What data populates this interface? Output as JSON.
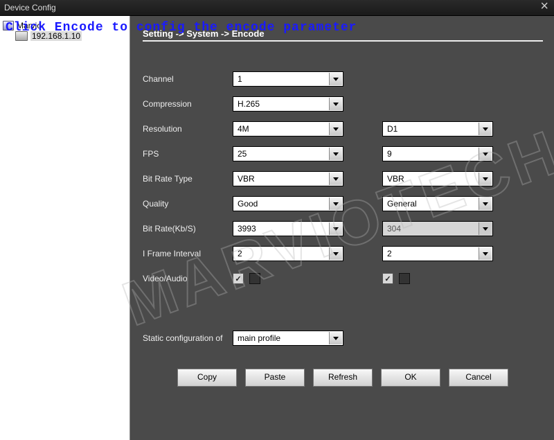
{
  "window_title": "Device Config",
  "overlay_hint": "Click Encode to config the encode parameter",
  "watermark": "MARVIOTECH",
  "tree": {
    "root": "Marvio",
    "device": "192.168.1.10"
  },
  "breadcrumb": "Setting -> System -> Encode",
  "labels": {
    "channel": "Channel",
    "compression": "Compression",
    "resolution": "Resolution",
    "fps": "FPS",
    "bitrate_type": "Bit Rate Type",
    "quality": "Quality",
    "bitrate": "Bit Rate(Kb/S)",
    "iframe": "I Frame Interval",
    "va": "Video/Audio",
    "static_cfg": "Static configuration of"
  },
  "main_stream": {
    "channel": "1",
    "compression": "H.265",
    "resolution": "4M",
    "fps": "25",
    "bitrate_type": "VBR",
    "quality": "Good",
    "bitrate": "3993",
    "iframe": "2"
  },
  "sub_stream": {
    "resolution": "D1",
    "fps": "9",
    "bitrate_type": "VBR",
    "quality": "General",
    "bitrate": "304",
    "iframe": "2"
  },
  "static_profile": "main profile",
  "buttons": {
    "copy": "Copy",
    "paste": "Paste",
    "refresh": "Refresh",
    "ok": "OK",
    "cancel": "Cancel"
  }
}
